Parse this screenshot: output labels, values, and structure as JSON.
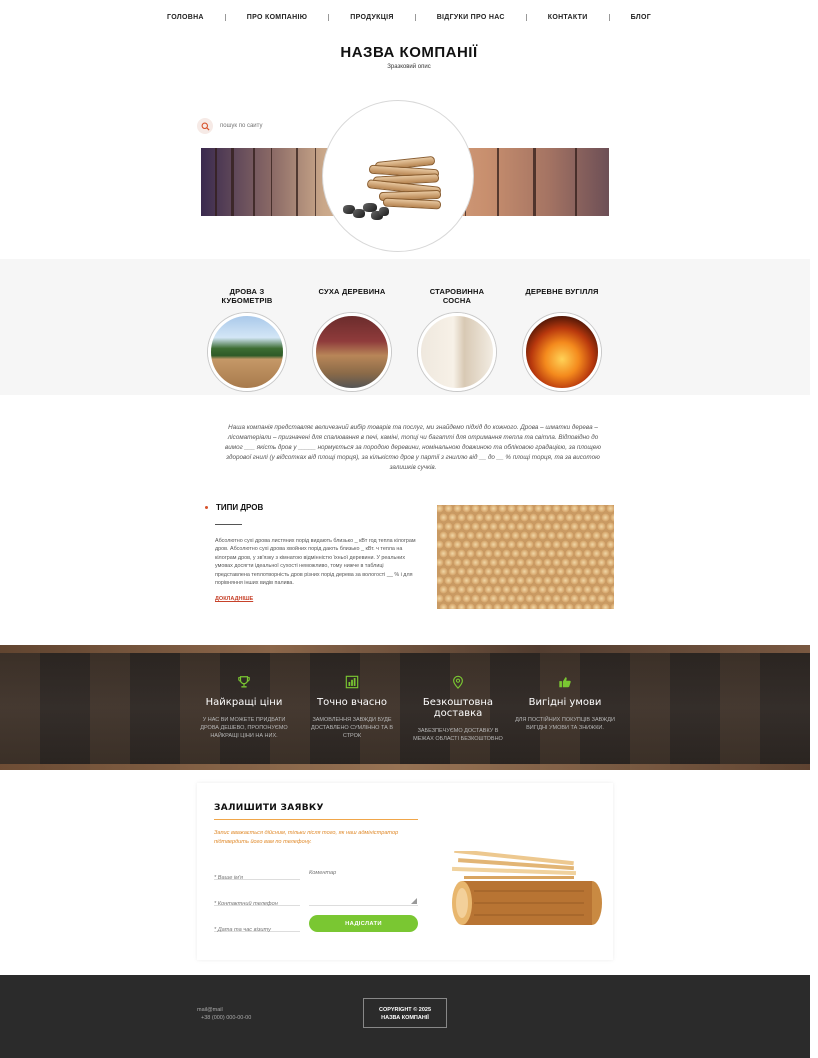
{
  "nav": {
    "items": [
      "ГОЛОВНА",
      "ПРО КОМПАНІЮ",
      "ПРОДУКЦІЯ",
      "ВІДГУКИ ПРО НАС",
      "КОНТАКТИ",
      "БЛОГ"
    ]
  },
  "brand": {
    "title": "НАЗВА КОМПАНІЇ",
    "subtitle": "Зразковий опис"
  },
  "search": {
    "placeholder": "пошук по сайту"
  },
  "categories": [
    {
      "name": "ДРОВА З КУБОМЕТРІВ"
    },
    {
      "name": "СУХА ДЕРЕВИНА"
    },
    {
      "name": "СТАРОВИННА СОСНА"
    },
    {
      "name": "ДЕРЕВНЕ ВУГІЛЛЯ"
    }
  ],
  "intro": {
    "text": "Наша компанія представляє величезний вибір товарів та послуг, ми знайдемо підхід до кожного. Дрова – шматки дерева – лісоматеріали – призначені для спалювання в печі, каміні, топці чи багатті для отримання тепла та світла. Відповідно до вимог ___ якість дров у _____ нормується за породою деревини, номінальною довжиною та обліковою градацією, за площею здорової гнилі (у відсотках від площі торця), за кількістю дров у партії з гниллю від __ до __ % площі торця, та за висотою залишків сучків."
  },
  "types": {
    "heading": "ТИПИ ДРОВ",
    "text": "Абсолютно сухі дрова листяних порід видають близько _ кВт год тепла кілограм дров. Абсолютно сухі дрова хвойних порід дають близько _ кВт. ч тепла на кілограм дров, у зв'язку з кімнатою відмінністю їхньої деревини. У реальних умовах досягти ідеальної сухості неможливо, тому нижче в таблиці представлена теплотворність дров різних порід дерева за вологості __ % і для порівняння інших видів палива.",
    "more_label": "ДОКЛАДНІШЕ"
  },
  "features": [
    {
      "icon": "trophy-icon",
      "title": "Найкращі ціни",
      "desc": "У НАС ВИ МОЖЕТЕ ПРИДБАТИ ДРОВА ДЕШЕВО, ПРОПОНУЄМО НАЙКРАЩІ ЦІНИ НА НИХ."
    },
    {
      "icon": "chart-icon",
      "title": "Точно вчасно",
      "desc": "ЗАМОВЛЕННЯ ЗАВЖДИ БУДЕ ДОСТАВЛЕНО СУМЛІННО ТА В СТРОК"
    },
    {
      "icon": "location-pin-icon",
      "title": "Безкоштовна доставка",
      "desc": "ЗАБЕЗПЕЧУЄМО ДОСТАВКУ В МЕЖАХ ОБЛАСТІ БЕЗКОШТОВНО"
    },
    {
      "icon": "thumbs-up-icon",
      "title": "Вигідні умови",
      "desc": "ДЛЯ ПОСТІЙНИХ ПОКУПЦІВ ЗАВЖДИ ВИГІДНІ УМОВИ ТА ЗНИЖКИ."
    }
  ],
  "form": {
    "title": "ЗАЛИШИТИ ЗАЯВКУ",
    "note": "Запис вважається дійсним, тільки після того, як наш адміністратор підтвердить його вам по телефону.",
    "name_placeholder": "* Ваше ім'я",
    "phone_placeholder": "* Контактний телефон",
    "date_placeholder": "* Дата та час візиту",
    "comment_placeholder": "Коментар",
    "submit_label": "НАДІСЛАТИ"
  },
  "footer": {
    "mail": "mail@mail",
    "phone": "+38 (000) 000-00-00",
    "copyright_line1": "COPYRIGHT © 2025",
    "copyright_line2": "НАЗВА КОМПАНІЇ"
  },
  "colors": {
    "accent_red": "#d7522b",
    "accent_orange": "#f0a64a",
    "accent_green": "#7ac732",
    "footer_bg": "#2b2b2b"
  }
}
